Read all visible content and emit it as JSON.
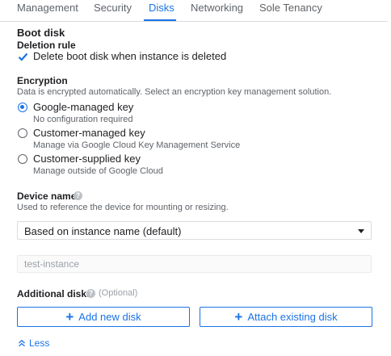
{
  "tabs": [
    {
      "label": "Management"
    },
    {
      "label": "Security"
    },
    {
      "label": "Disks"
    },
    {
      "label": "Networking"
    },
    {
      "label": "Sole Tenancy"
    }
  ],
  "active_tab": "Disks",
  "boot_disk": {
    "heading": "Boot disk",
    "deletion_rule_heading": "Deletion rule",
    "delete_checkbox_label": "Delete boot disk when instance is deleted",
    "delete_checked": true
  },
  "encryption": {
    "heading": "Encryption",
    "description": "Data is encrypted automatically. Select an encryption key management solution.",
    "options": [
      {
        "label": "Google-managed key",
        "hint": "No configuration required",
        "selected": true
      },
      {
        "label": "Customer-managed key",
        "hint": "Manage via Google Cloud Key Management Service",
        "selected": false
      },
      {
        "label": "Customer-supplied key",
        "hint": "Manage outside of Google Cloud",
        "selected": false
      }
    ]
  },
  "device_name": {
    "heading": "Device name",
    "help_icon": "?",
    "description": "Used to reference the device for mounting or resizing.",
    "select_value": "Based on instance name (default)",
    "input_placeholder": "test-instance"
  },
  "additional_disks": {
    "heading": "Additional disks",
    "help_icon": "?",
    "optional_label": "(Optional)",
    "add_button": "Add new disk",
    "attach_button": "Attach existing disk"
  },
  "less_link": "Less",
  "colors": {
    "accent": "#1a73e8",
    "text": "#202124",
    "secondary": "#5f6368"
  }
}
